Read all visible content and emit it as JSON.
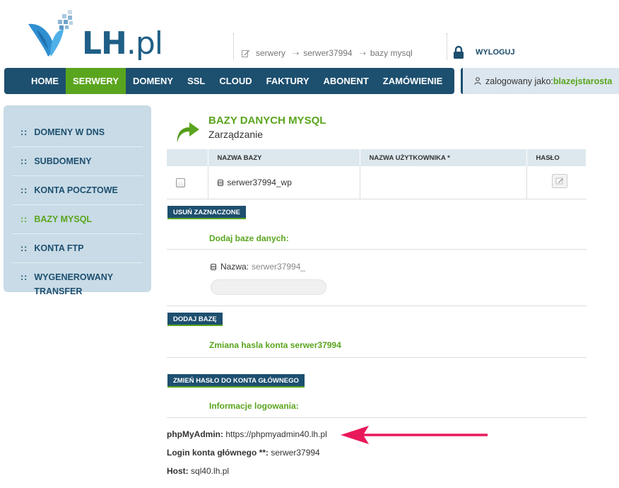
{
  "brand": {
    "name": "LH",
    "tld": ".pl"
  },
  "breadcrumb": {
    "items": [
      "serwery",
      "serwer37994",
      "bazy mysql"
    ],
    "arrow": "⇢"
  },
  "logout": {
    "label": "WYLOGUJ"
  },
  "nav": {
    "items": [
      "HOME",
      "SERWERY",
      "DOMENY",
      "SSL",
      "CLOUD",
      "FAKTURY",
      "ABONENT",
      "ZAMÓWIENIE"
    ],
    "active_index": 1
  },
  "user": {
    "prefix": "zalogowany jako:",
    "username": "blazejstarosta"
  },
  "sidebar": {
    "bullet": "::",
    "items": [
      "DOMENY W DNS",
      "SUBDOMENY",
      "KONTA POCZTOWE",
      "BAZY MYSQL",
      "KONTA FTP",
      "WYGENEROWANY TRANSFER"
    ],
    "active_index": 3
  },
  "page": {
    "title": "BAZY DANYCH MYSQL",
    "subtitle": "Zarządzanie"
  },
  "table": {
    "headers": [
      "",
      "NAZWA BAZY",
      "NAZWA UŻYTKOWNIKA *",
      "HASŁO"
    ],
    "rows": [
      {
        "db_name": "serwer37994_wp",
        "username": "",
        "checked": false
      }
    ]
  },
  "buttons": {
    "delete_selected": "USUŃ ZAZNACZONE",
    "add_db": "DODAJ BAZĘ",
    "change_password": "ZMIEŃ HASŁO DO KONTA GŁÓWNEGO"
  },
  "add_db": {
    "heading": "Dodaj baze danych:",
    "name_label": "Nazwa:",
    "name_prefix": "serwer37994_",
    "input_value": ""
  },
  "change_pw": {
    "heading": "Zmiana hasla konta serwer37994"
  },
  "login_info": {
    "heading": "Informacje logowania:",
    "phpmyadmin_label": "phpMyAdmin:",
    "phpmyadmin_url": "https://phpmyadmin40.lh.pl",
    "login_label": "Login konta głównego **:",
    "login_value": "serwer37994",
    "host_label": "Host:",
    "host_value": "sql40.lh.pl"
  },
  "colors": {
    "navy": "#1d4f6f",
    "green": "#5aa51e",
    "annotation": "#e8195a"
  },
  "icons": [
    "logo-butterfly-icon",
    "edit-icon",
    "arrow-right-icon",
    "lock-icon",
    "user-icon",
    "database-icon",
    "green-curved-arrow-icon",
    "key-edit-icon",
    "annotation-arrow-icon"
  ]
}
